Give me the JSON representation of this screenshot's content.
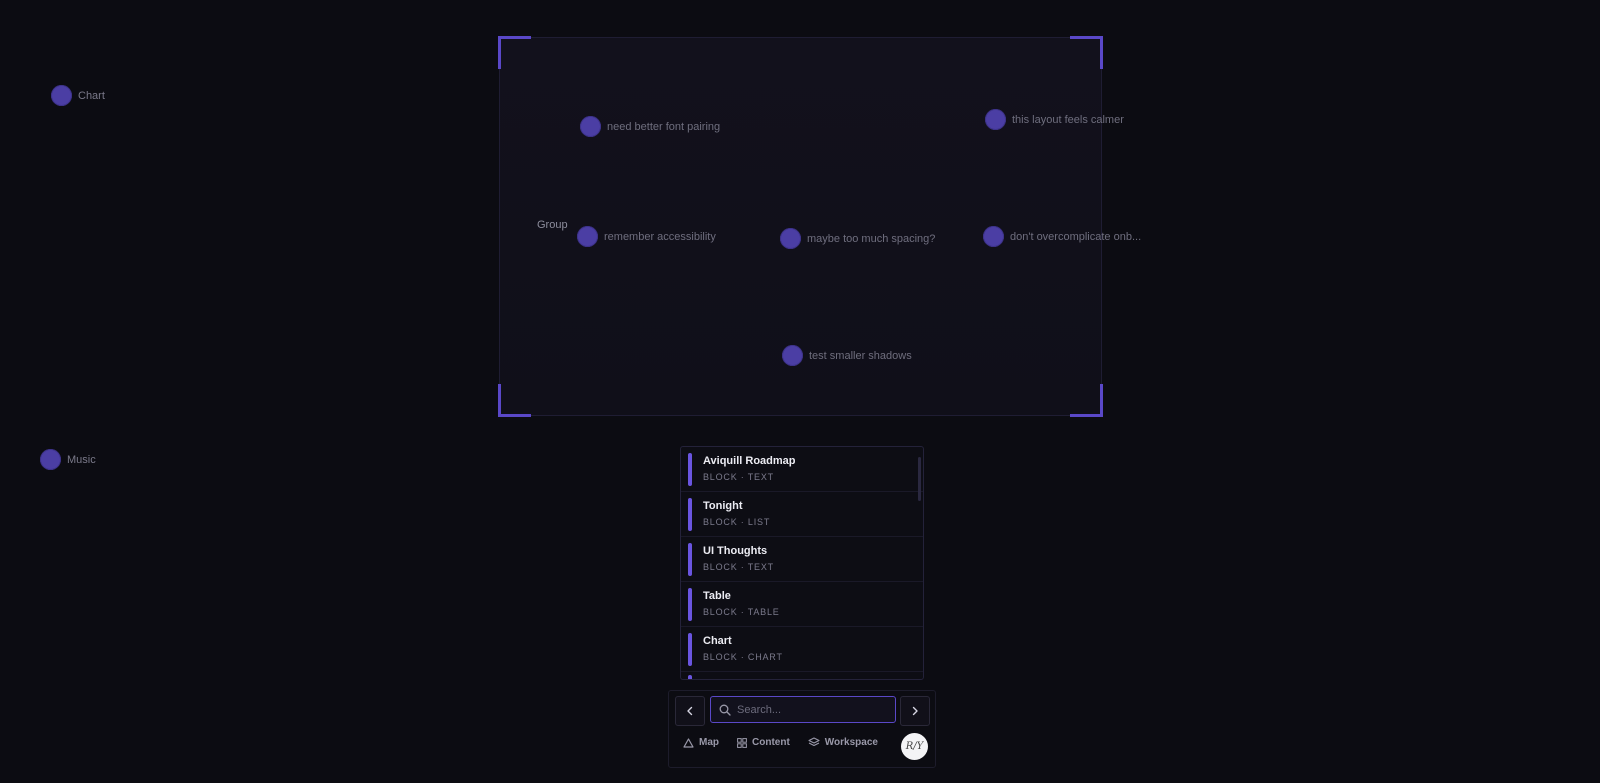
{
  "canvas": {
    "group": {
      "label": "Group"
    },
    "nodes_inside": [
      {
        "id": "n1",
        "label": "need better font pairing"
      },
      {
        "id": "n2",
        "label": "this layout feels calmer"
      },
      {
        "id": "n3",
        "label": "remember accessibility"
      },
      {
        "id": "n4",
        "label": "maybe too much spacing?"
      },
      {
        "id": "n5",
        "label": "don't overcomplicate onb..."
      },
      {
        "id": "n6",
        "label": "test smaller shadows"
      }
    ],
    "nodes_outside": [
      {
        "id": "chart",
        "label": "Chart"
      },
      {
        "id": "music",
        "label": "Music"
      }
    ]
  },
  "list": {
    "items": [
      {
        "title": "Aviquill Roadmap",
        "meta": "BLOCK · TEXT"
      },
      {
        "title": "Tonight",
        "meta": "BLOCK · LIST"
      },
      {
        "title": "UI Thoughts",
        "meta": "BLOCK · TEXT"
      },
      {
        "title": "Table",
        "meta": "BLOCK · TABLE"
      },
      {
        "title": "Chart",
        "meta": "BLOCK · CHART"
      }
    ]
  },
  "toolbar": {
    "search_placeholder": "Search...",
    "search_value": "",
    "tabs": [
      {
        "label": "Map",
        "icon": "triangle-icon"
      },
      {
        "label": "Content",
        "icon": "grid-icon"
      },
      {
        "label": "Workspace",
        "icon": "layers-icon"
      }
    ],
    "avatar_text": "R/Y"
  },
  "colors": {
    "background": "#0c0c12",
    "accent": "#5a48c8",
    "node": "#4b3ea4",
    "list_bar": "#6a55e0"
  }
}
